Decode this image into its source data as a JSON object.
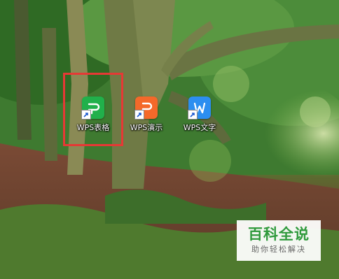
{
  "desktop": {
    "icons": [
      {
        "label": "WPS表格",
        "app": "spreadsheet-icon",
        "color": "#21b04b"
      },
      {
        "label": "WPS演示",
        "app": "presentation-icon",
        "color": "#f4692a"
      },
      {
        "label": "WPS文字",
        "app": "writer-icon",
        "color": "#2c8ef0"
      }
    ],
    "highlight_color": "#e53935"
  },
  "watermark": {
    "title": "百科全说",
    "subtitle": "助你轻松解决",
    "title_color": "#2f9a3c"
  }
}
